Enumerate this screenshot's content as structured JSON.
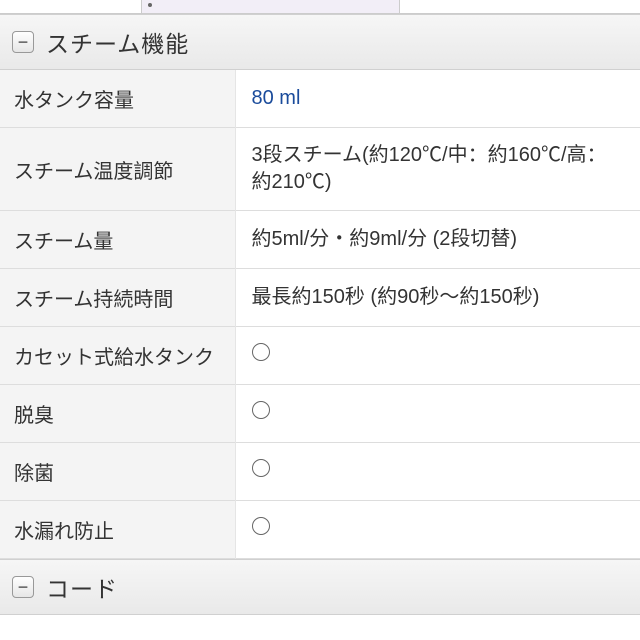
{
  "sections": [
    {
      "title": "スチーム機能",
      "collapse_glyph": "−",
      "rows": [
        {
          "label": "水タンク容量",
          "value": "80 ml",
          "is_link": true
        },
        {
          "label": "スチーム温度調節",
          "value": "3段スチーム(約120℃/中：約160℃/高：約210℃)"
        },
        {
          "label": "スチーム量",
          "value": "約5ml/分・約9ml/分 (2段切替)"
        },
        {
          "label": "スチーム持続時間",
          "value": "最長約150秒 (約90秒～約150秒)"
        },
        {
          "label": "カセット式給水タンク",
          "mark": "circle"
        },
        {
          "label": "脱臭",
          "mark": "circle"
        },
        {
          "label": "除菌",
          "mark": "circle"
        },
        {
          "label": "水漏れ防止",
          "mark": "circle"
        }
      ]
    },
    {
      "title": "コード",
      "collapse_glyph": "−",
      "rows": []
    }
  ]
}
